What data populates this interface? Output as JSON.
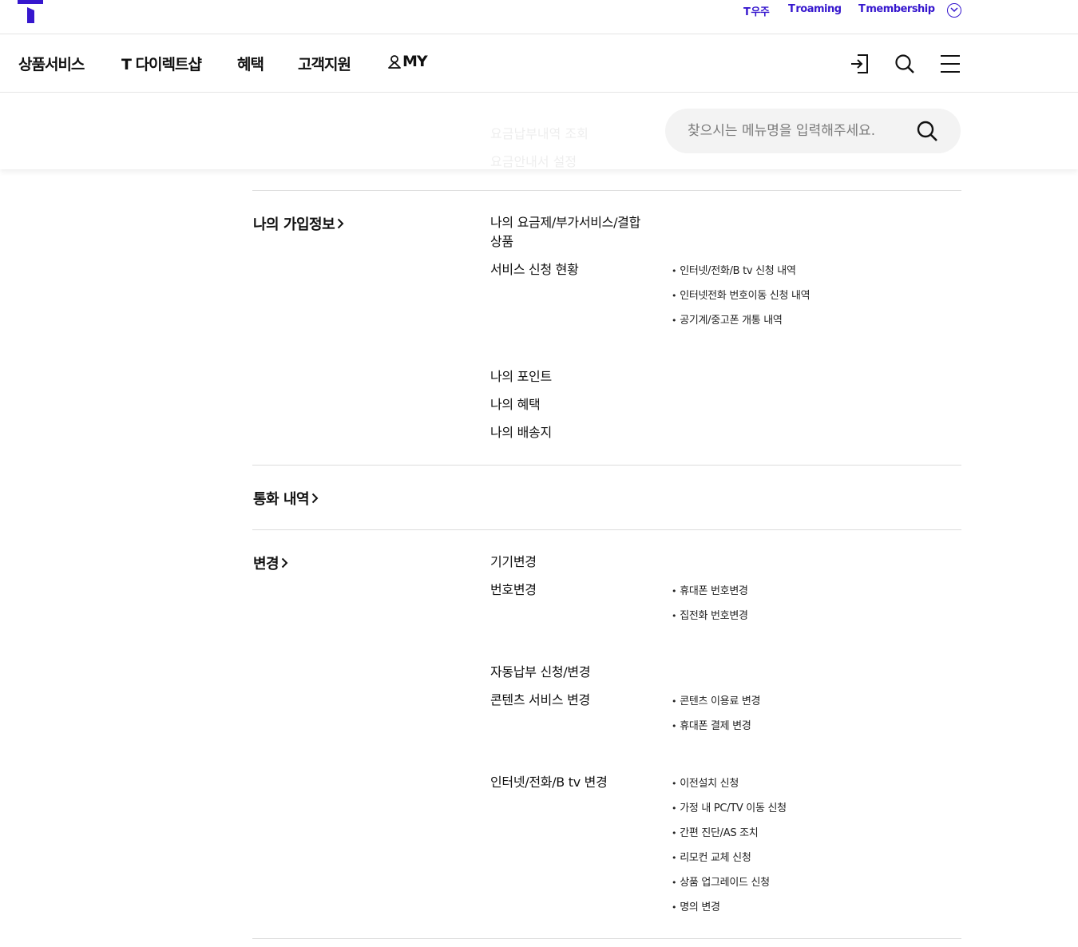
{
  "utility": {
    "links": [
      {
        "mark": "T",
        "label": "우주"
      },
      {
        "mark": "T",
        "label": "roaming"
      },
      {
        "mark": "T",
        "label": "membership"
      }
    ]
  },
  "gnb": {
    "items": [
      "상품서비스",
      "T 다이렉트샵",
      "혜택",
      "고객지원",
      "MY"
    ]
  },
  "search": {
    "placeholder": "찾으시는 메뉴명을 입력해주세요.",
    "behind_items": [
      "요금납부내역 조회",
      "요금안내서 설정"
    ]
  },
  "sections": {
    "signup": {
      "title": "나의 가입정보",
      "items": [
        "나의 요금제/부가서비스/결합상품",
        "서비스 신청 현황",
        "나의 포인트",
        "나의 혜택",
        "나의 배송지"
      ],
      "service_status_children": [
        "인터넷/전화/B tv 신청 내역",
        "인터넷전화 번호이동 신청 내역",
        "공기계/중고폰 개통 내역"
      ]
    },
    "calls": {
      "title": "통화 내역"
    },
    "change": {
      "title": "변경",
      "items": [
        "기기변경",
        "번호변경",
        "자동납부 신청/변경",
        "콘텐츠 서비스 변경",
        "인터넷/전화/B tv 변경"
      ],
      "number_children": [
        "휴대폰 번호변경",
        "집전화 번호변경"
      ],
      "content_children": [
        "콘텐츠 이용료 변경",
        "휴대폰 결제 변경"
      ],
      "internet_children": [
        "이전설치 신청",
        "가정 내 PC/TV 이동 신청",
        "간편 진단/AS 조치",
        "리모컨 교체 신청",
        "상품 업그레이드 신청",
        "명의 변경"
      ]
    }
  },
  "colors": {
    "brand": "#3617ce",
    "text": "#111111",
    "divider": "#dcdcdc",
    "search_bg": "#f3f3f3"
  },
  "icons": [
    "t-logo-icon",
    "chevron-down-icon",
    "user-icon",
    "login-icon",
    "search-icon",
    "hamburger-menu-icon",
    "chevron-right-icon"
  ]
}
